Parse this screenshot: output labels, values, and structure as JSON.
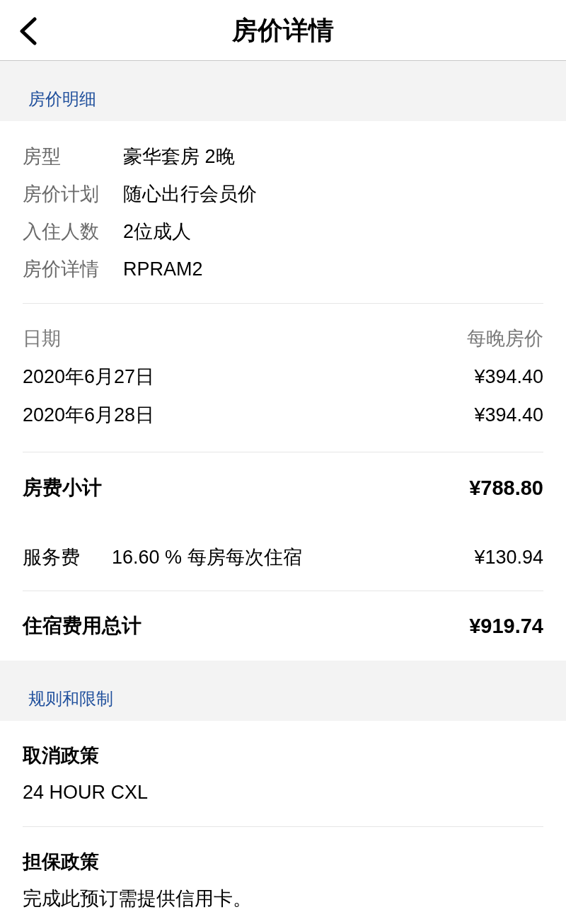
{
  "nav_bar": {
    "title": "房价详情"
  },
  "price_section": {
    "title": "房价明细",
    "details": [
      {
        "label": "房型",
        "value": "豪华套房 2晚"
      },
      {
        "label": "房价计划",
        "value": "随心出行会员价"
      },
      {
        "label": "入住人数",
        "value": "2位成人"
      },
      {
        "label": "房价详情",
        "value": "RPRAM2"
      }
    ],
    "nightly": {
      "columns": [
        "日期",
        "每晚房价"
      ],
      "rows": [
        {
          "date": "2020年6月27日",
          "price": "¥394.40"
        },
        {
          "date": "2020年6月28日",
          "price": "¥394.40"
        }
      ]
    },
    "subtotal": {
      "label": "房费小计",
      "amount": "¥788.80"
    },
    "fees": [
      {
        "label": "服务费",
        "description": "16.60 % 每房每次住宿",
        "amount": "¥130.94"
      }
    ],
    "total": {
      "label": "住宿费用总计",
      "amount": "¥919.74"
    }
  },
  "rules_section": {
    "title": "规则和限制",
    "policies": [
      {
        "title": "取消政策",
        "text": "24 HOUR CXL"
      },
      {
        "title": "担保政策",
        "text": "完成此预订需提供信用卡。"
      }
    ]
  }
}
